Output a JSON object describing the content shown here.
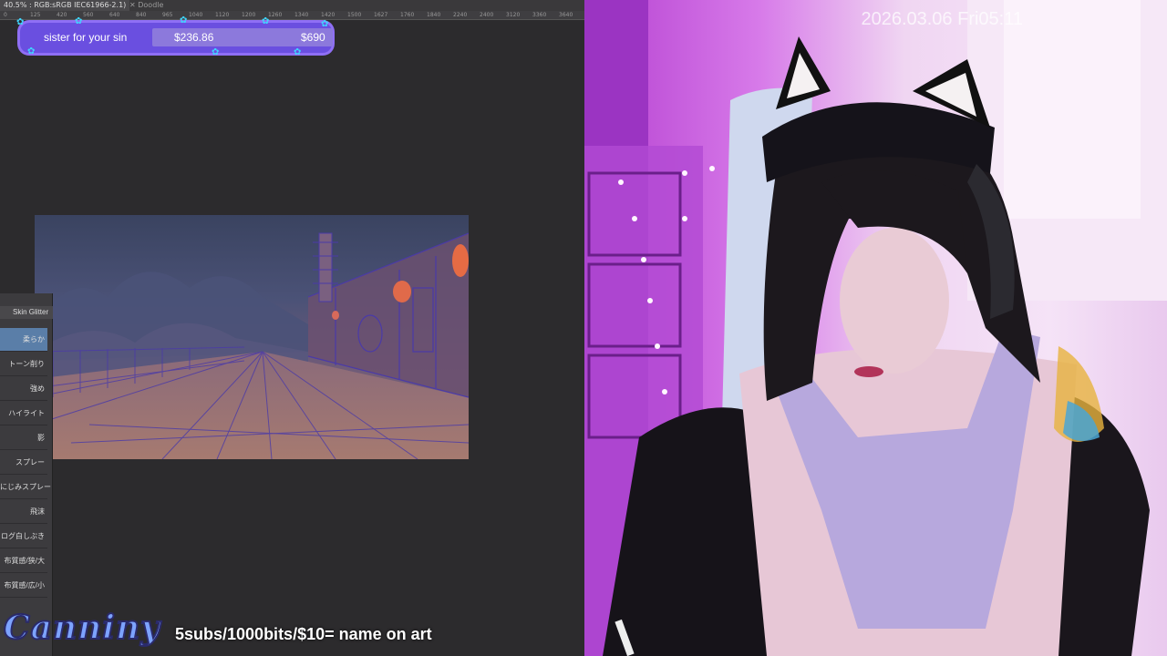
{
  "editor": {
    "tab_active": "40.5% : RGB:sRGB IEC61966-2.1)",
    "tab_inactive": "Doodle",
    "ruler_ticks": [
      "0",
      "125",
      "420",
      "560",
      "640",
      "840",
      "965",
      "1040",
      "1120",
      "1200",
      "1260",
      "1340",
      "1420",
      "1500",
      "1627",
      "1760",
      "1840",
      "2240",
      "2400",
      "3120",
      "3360",
      "3640"
    ]
  },
  "goal_bar": {
    "label": "sister for your sin",
    "current": "$236.86",
    "target": "$690",
    "progress": 0.343
  },
  "brush_panel": {
    "title": "Skin Glitter",
    "items": [
      "柔らか",
      "トーン削り",
      "強め",
      "ハイライト",
      "影",
      "スプレー",
      "にじみスプレー",
      "飛沫",
      "ログ白しぶき",
      "布質感/狭/大",
      "布質感/広/小"
    ],
    "selected_index": 0
  },
  "footer": {
    "logo": "Canniny",
    "promo": "5subs/1000bits/$10= name on art"
  },
  "webcam": {
    "timestamp": "2026.03.06 Fri05:11"
  },
  "colors": {
    "goal_bg": "#6a4fe0",
    "goal_accent": "#3fd6ff",
    "logo": "#7da3ff",
    "room_light": "#c060dd"
  }
}
